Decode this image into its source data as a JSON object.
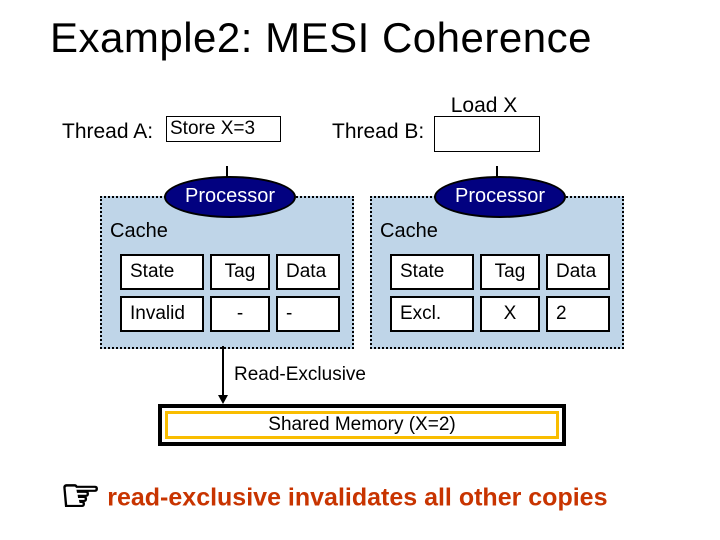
{
  "title": "Example2: MESI Coherence",
  "threadA": {
    "label": "Thread A:",
    "box": "Store X=3"
  },
  "threadB": {
    "label": "Thread B:",
    "above": "Load X"
  },
  "processor_label": "Processor",
  "cache_label": "Cache",
  "headers": {
    "state": "State",
    "tag": "Tag",
    "data": "Data"
  },
  "left": {
    "state": "Invalid",
    "tag": "-",
    "data": "-"
  },
  "right": {
    "state": "Excl.",
    "tag": "X",
    "data": "2"
  },
  "arrow_label": "Read-Exclusive",
  "memory": "Shared Memory (X=2)",
  "footnote": "read-exclusive invalidates all other copies"
}
